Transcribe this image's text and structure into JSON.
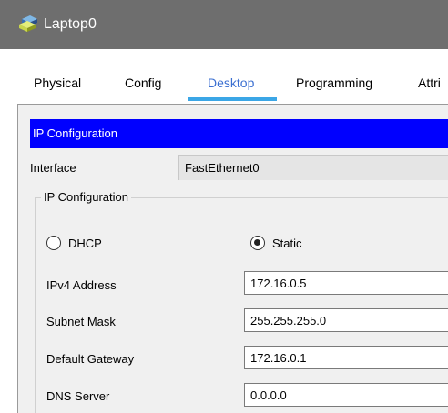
{
  "window": {
    "title": "Laptop0"
  },
  "tabs": [
    {
      "label": "Physical"
    },
    {
      "label": "Config"
    },
    {
      "label": "Desktop"
    },
    {
      "label": "Programming"
    },
    {
      "label": "Attri"
    }
  ],
  "active_tab": "Desktop",
  "ip_config": {
    "header": "IP Configuration",
    "interface_label": "Interface",
    "interface_value": "FastEthernet0",
    "group_title": "IP Configuration",
    "dhcp_label": "DHCP",
    "static_label": "Static",
    "selected_mode": "Static",
    "fields": {
      "ipv4_label": "IPv4 Address",
      "ipv4_value": "172.16.0.5",
      "subnet_label": "Subnet Mask",
      "subnet_value": "255.255.255.0",
      "gateway_label": "Default Gateway",
      "gateway_value": "172.16.0.1",
      "dns_label": "DNS Server",
      "dns_value": "0.0.0.0"
    }
  },
  "colors": {
    "titlebar": "#6e6e6e",
    "header_bar": "#0000ff",
    "active_tab_text": "#3b6fd1",
    "tab_underline": "#3ba6e6"
  },
  "icons": {
    "app": "laptop-app-icon"
  }
}
